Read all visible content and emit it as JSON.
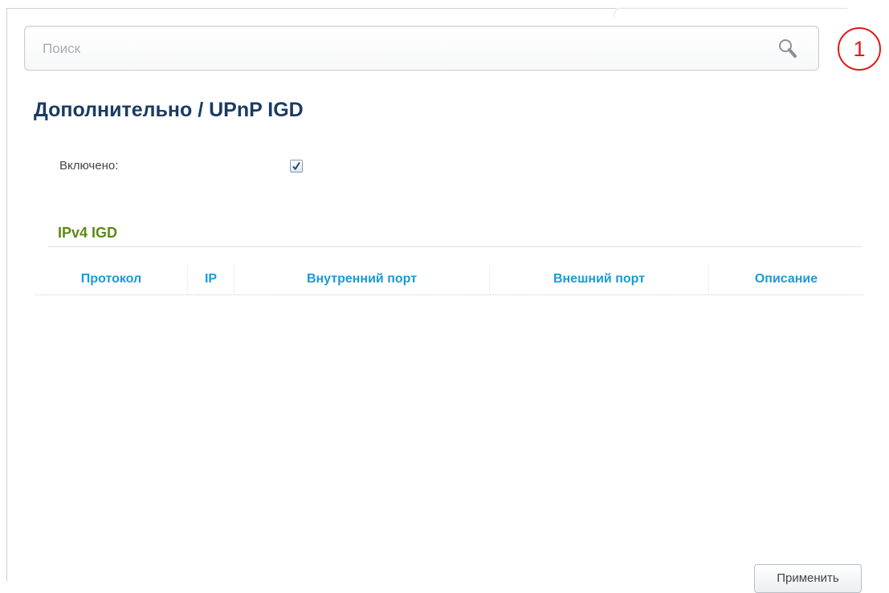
{
  "search": {
    "placeholder": "Поиск",
    "value": ""
  },
  "callout": {
    "label": "1",
    "color": "#e01919"
  },
  "page": {
    "title": "Дополнительно /  UPnP IGD"
  },
  "settings": {
    "enabled_label": "Включено:",
    "enabled": true
  },
  "section": {
    "title": "IPv4 IGD"
  },
  "table": {
    "columns": [
      "Протокол",
      "IP",
      "Внутренний порт",
      "Внешний порт",
      "Описание"
    ],
    "rows": []
  },
  "actions": {
    "apply_label": "Применить"
  },
  "colors": {
    "title": "#1a3c64",
    "section_title": "#5c8a15",
    "table_header": "#1a9ad6"
  },
  "icons": {
    "search": "search-icon",
    "checkmark": "checkmark-icon"
  }
}
